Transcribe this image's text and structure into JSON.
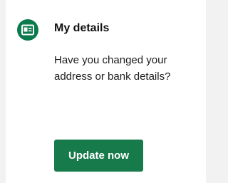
{
  "card": {
    "icon": "id-card-icon",
    "title": "My details",
    "description": "Have you changed your address or bank details?",
    "button_label": "Update now"
  },
  "colors": {
    "accent": "#167a4a",
    "icon_badge": "#0c7a4c",
    "background": "#f2f2f2",
    "card": "#ffffff"
  }
}
